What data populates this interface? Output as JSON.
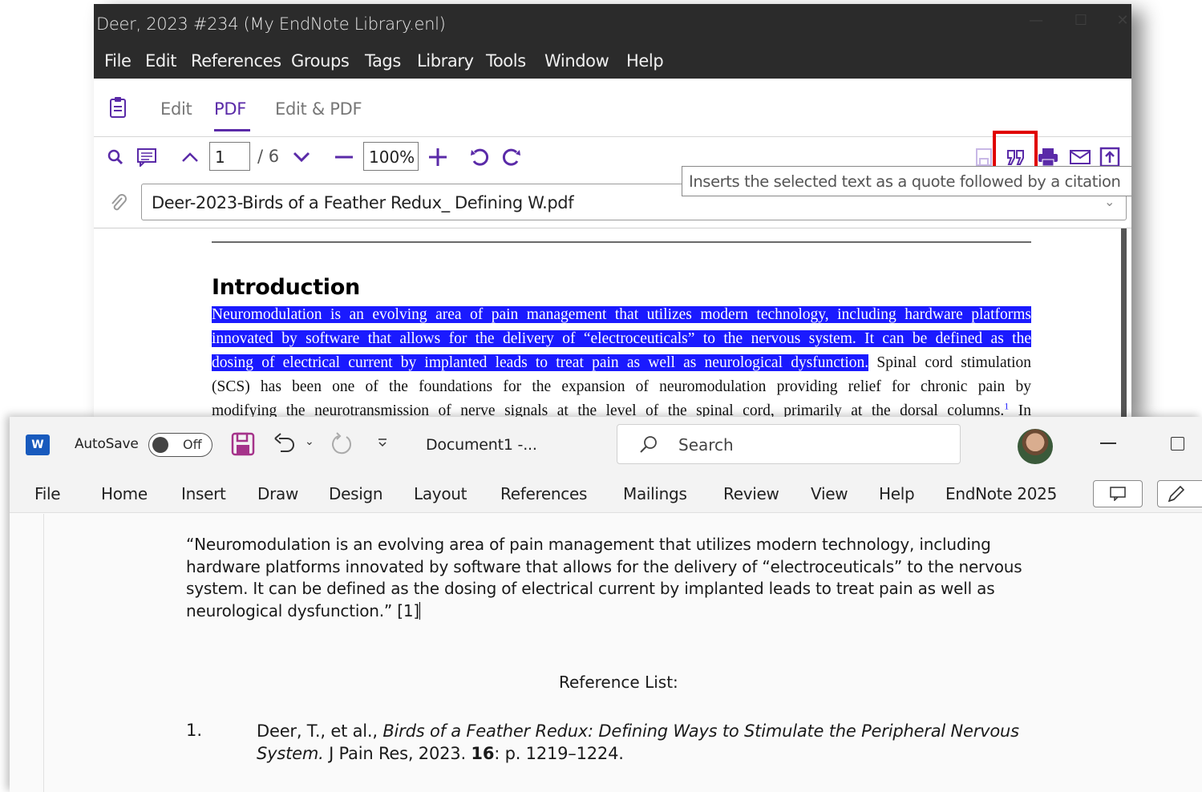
{
  "endnote": {
    "window_title": "Deer, 2023 #234 (My EndNote Library.enl)",
    "window_controls": {
      "minimize": "—",
      "maximize": "☐",
      "close": "✕"
    },
    "menu": [
      "File",
      "Edit",
      "References",
      "Groups",
      "Tags",
      "Library",
      "Tools",
      "Window",
      "Help"
    ],
    "tabs": [
      "Edit",
      "PDF",
      "Edit & PDF"
    ],
    "active_tab": "PDF",
    "toolbar": {
      "page_current": "1",
      "page_total": "/ 6",
      "zoom": "100%"
    },
    "tooltip": "Inserts the selected text as a quote followed by a citation",
    "attached_file": "Deer-2023-Birds of a Feather Redux_ Defining W.pdf",
    "pdf": {
      "heading": "Introduction",
      "line1_hl": "Neuromodulation is an evolving area of pain management that utilizes modern technology, including hardware platforms",
      "line2_hl": "innovated by software that allows for the delivery of “electroceuticals” to the nervous system. It can be defined as the",
      "line3_hl": "dosing of electrical current by implanted leads to treat pain as well as neurological dysfunction.",
      "line3_rest": " Spinal cord stimulation",
      "line4": "(SCS) has been one of the foundations for the expansion of neuromodulation providing relief for chronic pain by",
      "line5": "modifying the neurotransmission of nerve signals at the level of the spinal cord, primarily at the dorsal columns.",
      "line5_sup": "1",
      "line5_end": " In"
    },
    "colors": {
      "accent": "#5a2aa8",
      "highlight": "#1a1aff",
      "callout": "#e00000"
    }
  },
  "word": {
    "autosave_label": "AutoSave",
    "autosave_state": "Off",
    "doc_title": "Document1  -...",
    "search_placeholder": "Search",
    "tabs": [
      "File",
      "Home",
      "Insert",
      "Draw",
      "Design",
      "Layout",
      "References",
      "Mailings",
      "Review",
      "View",
      "Help",
      "EndNote 2025"
    ],
    "quote": "“Neuromodulation is an evolving area of pain management that utilizes modern technology, including hardware platforms innovated by software that allows for the delivery of “electroceuticals” to the nervous system. It can be defined as the dosing of electrical current by implanted leads to treat pain as well as neurological dysfunction.” [1]",
    "reference_heading": "Reference List:",
    "reference": {
      "number": "1.",
      "authors": "Deer, T., et al., ",
      "title": "Birds of a Feather Redux: Defining Ways to Stimulate the Peripheral Nervous System.",
      "journal": " J Pain Res, 2023. ",
      "volume": "16",
      "pages": ": p. 1219–1224."
    },
    "colors": {
      "brand": "#185abd",
      "save_icon": "#a5338a"
    }
  }
}
